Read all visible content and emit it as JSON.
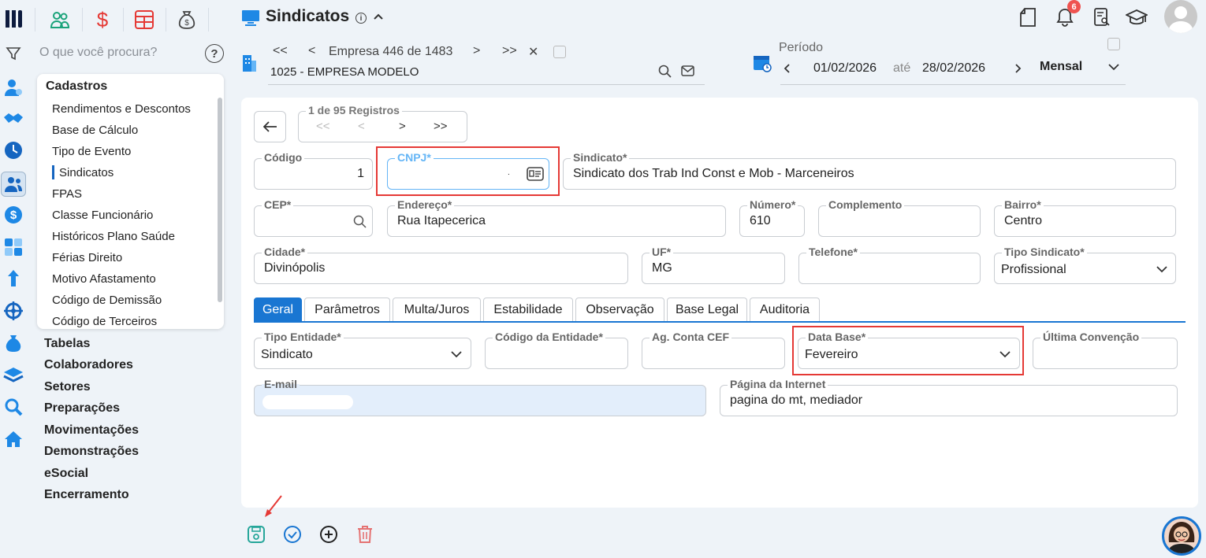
{
  "app": {
    "title": "Sindicatos",
    "notifications_count": "6"
  },
  "search": {
    "placeholder": "O que você procura?"
  },
  "menu": {
    "section": "Cadastros",
    "items": [
      "Rendimentos e Descontos",
      "Base de Cálculo",
      "Tipo de Evento",
      "Sindicatos",
      "FPAS",
      "Classe Funcionário",
      "Históricos Plano Saúde",
      "Férias Direito",
      "Motivo Afastamento",
      "Código de Demissão",
      "Código de Terceiros"
    ],
    "active": "Sindicatos"
  },
  "nav": [
    "Tabelas",
    "Colaboradores",
    "Setores",
    "Preparações",
    "Movimentações",
    "Demonstrações",
    "eSocial",
    "Encerramento"
  ],
  "empresa": {
    "nav_first": "<<",
    "nav_prev": "<",
    "position": "Empresa 446 de 1483",
    "nav_next": ">",
    "nav_last": ">>",
    "close": "✕",
    "name": "1025 - EMPRESA MODELO"
  },
  "periodo": {
    "label": "Período",
    "start": "01/02/2026",
    "sep": "até",
    "end": "28/02/2026",
    "mode": "Mensal"
  },
  "records": {
    "label": "1 de 95 Registros",
    "first": "<<",
    "prev": "<",
    "next": ">",
    "last": ">>"
  },
  "form": {
    "codigo": {
      "label": "Código",
      "value": "1"
    },
    "cnpj": {
      "label": "CNPJ*",
      "value": "."
    },
    "sindicato": {
      "label": "Sindicato*",
      "value": "Sindicato dos Trab Ind Const e Mob - Marceneiros"
    },
    "cep": {
      "label": "CEP*",
      "value": ""
    },
    "endereco": {
      "label": "Endereço*",
      "value": "Rua Itapecerica"
    },
    "numero": {
      "label": "Número*",
      "value": "610"
    },
    "complemento": {
      "label": "Complemento",
      "value": ""
    },
    "bairro": {
      "label": "Bairro*",
      "value": "Centro"
    },
    "cidade": {
      "label": "Cidade*",
      "value": "Divinópolis"
    },
    "uf": {
      "label": "UF*",
      "value": "MG"
    },
    "telefone": {
      "label": "Telefone*",
      "value": ""
    },
    "tipo_sindicato": {
      "label": "Tipo Sindicato*",
      "value": "Profissional"
    }
  },
  "tabs": [
    "Geral",
    "Parâmetros",
    "Multa/Juros",
    "Estabilidade",
    "Observação",
    "Base Legal",
    "Auditoria"
  ],
  "geral": {
    "tipo_entidade": {
      "label": "Tipo Entidade*",
      "value": "Sindicato"
    },
    "codigo_entidade": {
      "label": "Código da Entidade*",
      "value": ""
    },
    "ag_conta_cef": {
      "label": "Ag. Conta CEF",
      "value": ""
    },
    "data_base": {
      "label": "Data Base*",
      "value": "Fevereiro"
    },
    "ultima_convencao": {
      "label": "Última Convenção",
      "value": ""
    },
    "email": {
      "label": "E-mail",
      "value": ""
    },
    "pagina_internet": {
      "label": "Página da Internet",
      "value": "pagina do mt, mediador"
    }
  },
  "colors": {
    "primary": "#1976d2",
    "highlight": "#e53935",
    "save": "#26a69a",
    "delete": "#e57373"
  }
}
